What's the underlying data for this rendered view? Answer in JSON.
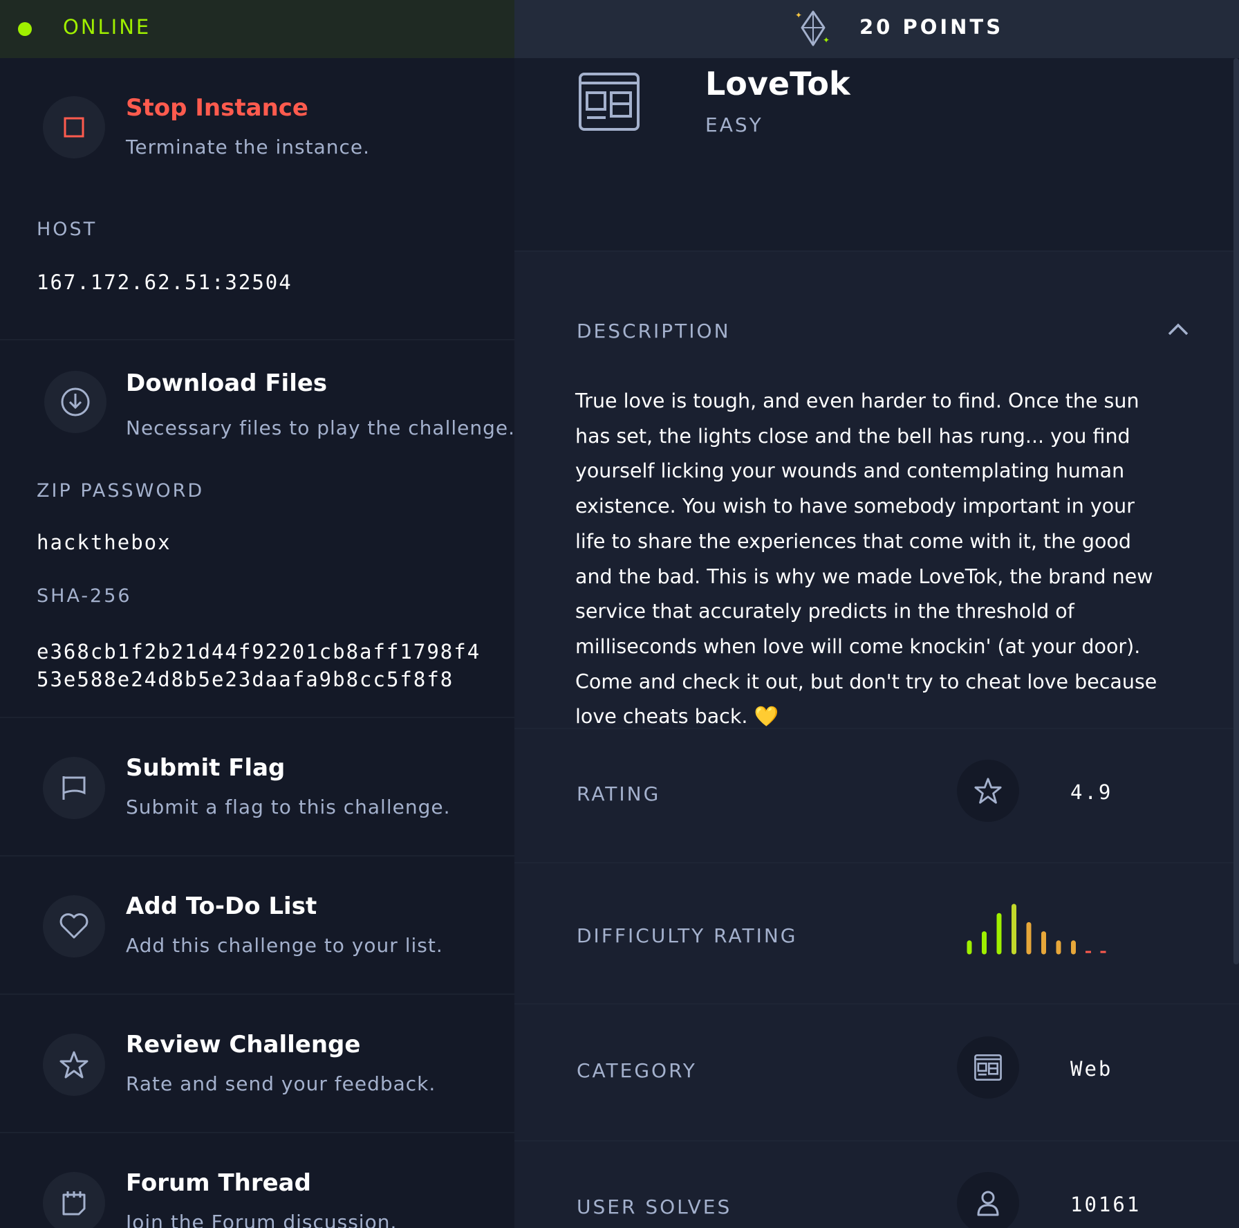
{
  "status": {
    "text": "ONLINE",
    "color": "#9fef00"
  },
  "points": {
    "text": "20 POINTS"
  },
  "actions": {
    "stop": {
      "title": "Stop Instance",
      "subtitle": "Terminate the instance."
    },
    "download": {
      "title": "Download Files",
      "subtitle": "Necessary files to play the challenge."
    },
    "submit": {
      "title": "Submit Flag",
      "subtitle": "Submit a flag to this challenge."
    },
    "todo": {
      "title": "Add To-Do List",
      "subtitle": "Add this challenge to your list."
    },
    "review": {
      "title": "Review Challenge",
      "subtitle": "Rate and send your feedback."
    },
    "forum": {
      "title": "Forum Thread",
      "subtitle": "Join the Forum discussion."
    }
  },
  "host": {
    "label": "HOST",
    "value": "167.172.62.51:32504"
  },
  "zip": {
    "label": "ZIP PASSWORD",
    "value": "hackthebox"
  },
  "sha": {
    "label": "SHA-256",
    "line1": "e368cb1f2b21d44f92201cb8aff1798f4",
    "line2": "53e588e24d8b5e23daafa9b8cc5f8f8"
  },
  "challenge": {
    "name": "LoveTok",
    "difficulty": "EASY"
  },
  "description": {
    "label": "DESCRIPTION",
    "text": "True love is tough, and even harder to find. Once the sun has set, the lights close and the bell has rung... you find yourself licking your wounds and contemplating human existence. You wish to have somebody important in your life to share the experiences that come with it, the good and the bad. This is why we made LoveTok, the brand new service that accurately predicts in the threshold of milliseconds when love will come knockin' (at your door). Come and check it out, but don't try to cheat love because love cheats back.",
    "emoji": "💛"
  },
  "stats": {
    "rating": {
      "label": "RATING",
      "value": "4.9"
    },
    "difficulty_rating": {
      "label": "DIFFICULTY RATING"
    },
    "category": {
      "label": "CATEGORY",
      "value": "Web"
    },
    "user_solves": {
      "label": "USER SOLVES",
      "value": "10161"
    }
  },
  "difficulty_bars": {
    "values": [
      1,
      2,
      4,
      5,
      3,
      2,
      1,
      1,
      0,
      0
    ],
    "colors": [
      "#9fef00",
      "#9fef00",
      "#9fef00",
      "#c3d92b",
      "#e7a73a",
      "#e7a73a",
      "#e7a73a",
      "#e7a73a",
      "#ff5b4e",
      "#ff5b4e"
    ]
  }
}
